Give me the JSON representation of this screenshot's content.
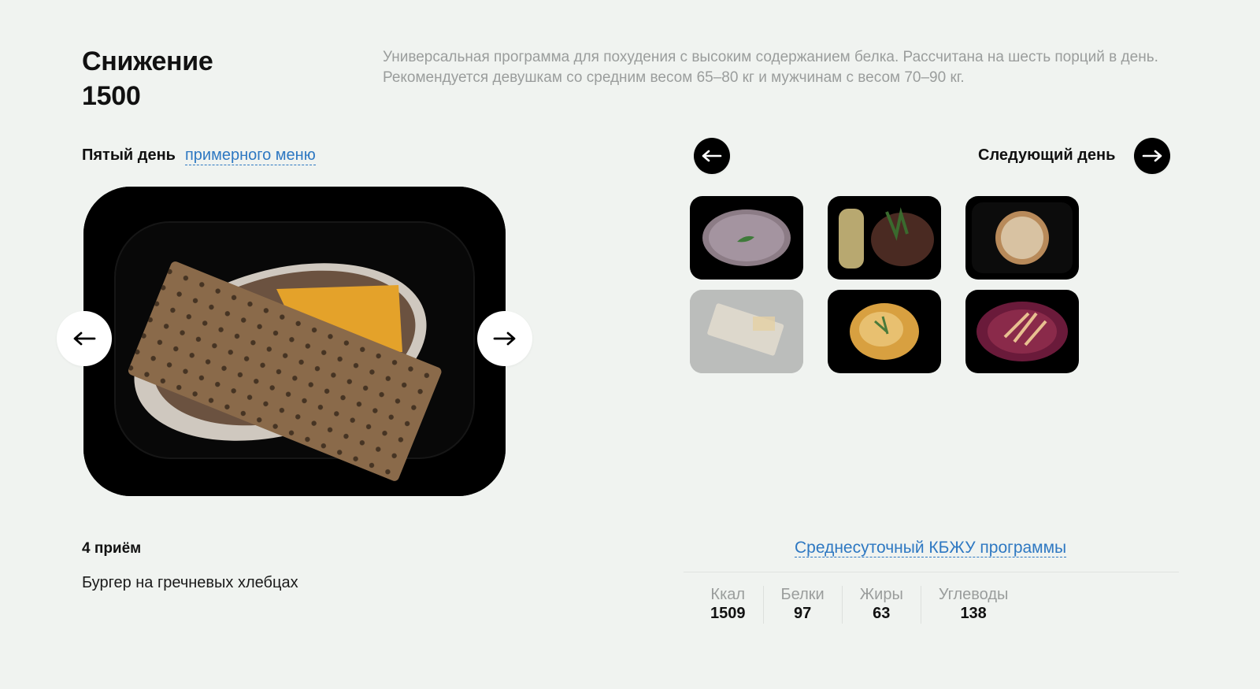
{
  "program": {
    "title_line1": "Снижение",
    "title_line2": "1500",
    "description": "Универсальная программа для похудения с высоким содержанием белка. Рассчитана на шесть порций в день. Рекомендуется девушкам со средним весом 65–80 кг и мужчинам с весом 70–90 кг."
  },
  "day": {
    "label": "Пятый день",
    "link": "примерного меню"
  },
  "navigation": {
    "prev_icon": "arrow-left-icon",
    "next_icon": "arrow-right-icon",
    "next_day_label": "Следующий день"
  },
  "meal": {
    "title": "4 приём",
    "name": "Бургер на гречневых хлебцах"
  },
  "thumbnails": [
    {
      "icon": "rice-dish-icon",
      "selected": false
    },
    {
      "icon": "beef-dish-icon",
      "selected": false
    },
    {
      "icon": "pie-dish-icon",
      "selected": false
    },
    {
      "icon": "burger-dish-icon",
      "selected": true
    },
    {
      "icon": "omelette-dish-icon",
      "selected": false
    },
    {
      "icon": "salad-dish-icon",
      "selected": false
    }
  ],
  "kbju": {
    "link": "Среднесуточный КБЖУ программы",
    "stats": [
      {
        "label": "Ккал",
        "value": "1509"
      },
      {
        "label": "Белки",
        "value": "97"
      },
      {
        "label": "Жиры",
        "value": "63"
      },
      {
        "label": "Углеводы",
        "value": "138"
      }
    ]
  },
  "colors": {
    "background": "#f0f3f0",
    "link": "#2e78c2",
    "muted_text": "#9a9d9c"
  }
}
